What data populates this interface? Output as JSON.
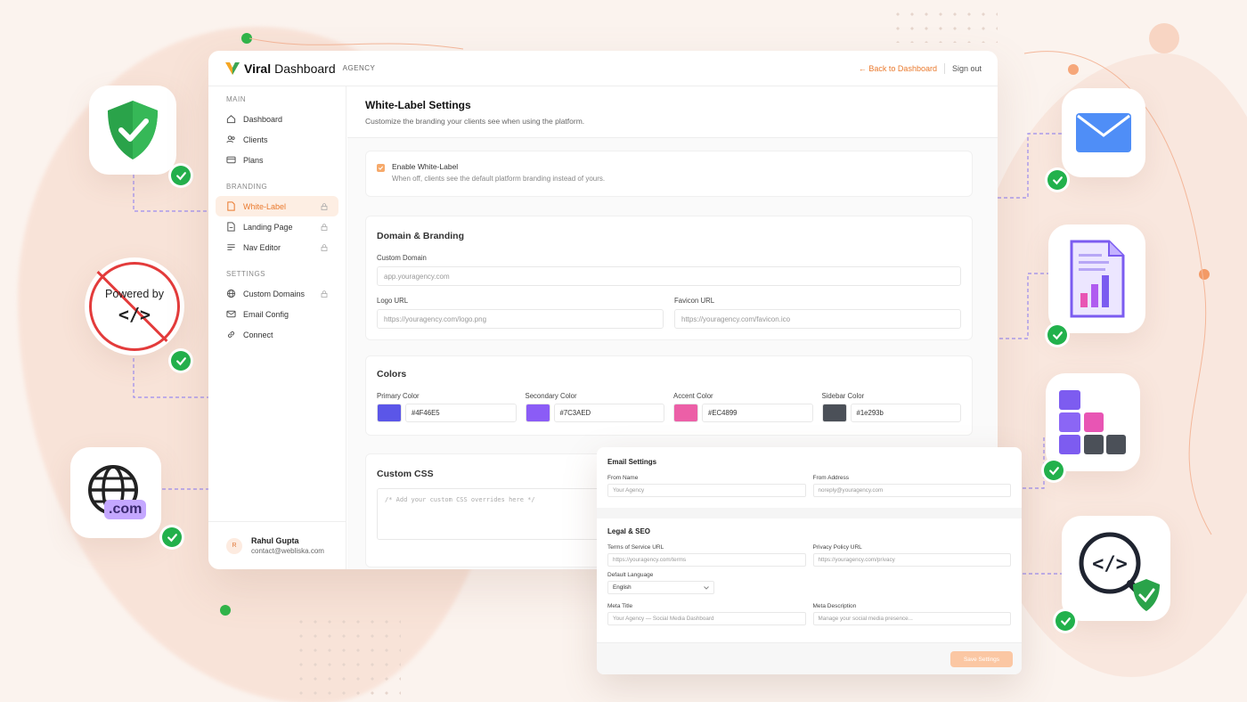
{
  "app": {
    "logo_name": "Viral",
    "logo_suffix": "Dashboard",
    "badge": "AGENCY",
    "back_link": "Back to Dashboard",
    "signout": "Sign out"
  },
  "sidebar": {
    "sections": [
      {
        "title": "MAIN",
        "items": [
          {
            "label": "Dashboard",
            "icon": "home-icon",
            "locked": false,
            "active": false
          },
          {
            "label": "Clients",
            "icon": "users-icon",
            "locked": false,
            "active": false
          },
          {
            "label": "Plans",
            "icon": "card-icon",
            "locked": false,
            "active": false
          }
        ]
      },
      {
        "title": "BRANDING",
        "items": [
          {
            "label": "White-Label",
            "icon": "document-icon",
            "locked": true,
            "active": true
          },
          {
            "label": "Landing Page",
            "icon": "page-icon",
            "locked": true,
            "active": false
          },
          {
            "label": "Nav Editor",
            "icon": "menu-icon",
            "locked": true,
            "active": false
          }
        ]
      },
      {
        "title": "SETTINGS",
        "items": [
          {
            "label": "Custom Domains",
            "icon": "globe-icon",
            "locked": true,
            "active": false
          },
          {
            "label": "Email Config",
            "icon": "mail-icon",
            "locked": false,
            "active": false
          },
          {
            "label": "Connect",
            "icon": "link-icon",
            "locked": false,
            "active": false
          }
        ]
      }
    ],
    "user": {
      "initial": "R",
      "name": "Rahul Gupta",
      "email": "contact@webliska.com"
    }
  },
  "page": {
    "title": "White-Label Settings",
    "subtitle": "Customize the branding your clients see when using the platform.",
    "enable": {
      "label": "Enable White-Label",
      "help": "When off, clients see the default platform branding instead of yours.",
      "checked": true
    },
    "domain": {
      "title": "Domain & Branding",
      "custom_domain_label": "Custom Domain",
      "custom_domain_placeholder": "app.youragency.com",
      "logo_label": "Logo URL",
      "logo_placeholder": "https://youragency.com/logo.png",
      "favicon_label": "Favicon URL",
      "favicon_placeholder": "https://youragency.com/favicon.ico"
    },
    "colors": {
      "title": "Colors",
      "items": [
        {
          "label": "Primary Color",
          "value": "#4F46E5",
          "swatch": "#5b56e8"
        },
        {
          "label": "Secondary Color",
          "value": "#7C3AED",
          "swatch": "#8b5cf6"
        },
        {
          "label": "Accent Color",
          "value": "#EC4899",
          "swatch": "#ec5fa7"
        },
        {
          "label": "Sidebar Color",
          "value": "#1e293b",
          "swatch": "#4b5058"
        }
      ]
    },
    "css": {
      "title": "Custom CSS",
      "placeholder": "/* Add your custom CSS overrides here */"
    }
  },
  "overlay": {
    "email_title": "Email Settings",
    "from_name_label": "From Name",
    "from_name_placeholder": "Your Agency",
    "from_address_label": "From Address",
    "from_address_placeholder": "noreply@youragency.com",
    "legal_title": "Legal & SEO",
    "terms_label": "Terms of Service URL",
    "terms_placeholder": "https://youragency.com/terms",
    "privacy_label": "Privacy Policy URL",
    "privacy_placeholder": "https://youragency.com/privacy",
    "language_label": "Default Language",
    "language_value": "English",
    "meta_title_label": "Meta Title",
    "meta_title_placeholder": "Your Agency — Social Media Dashboard",
    "meta_desc_label": "Meta Description",
    "meta_desc_placeholder": "Manage your social media presence...",
    "save_label": "Save Settings"
  },
  "decor": {
    "powered_by_text": "Powered by",
    "code_glyph": "</>",
    "domain_badge": ".com",
    "colors": {
      "accent": "#ea7a2e",
      "check": "#22b14c",
      "dash": "#9b8cf0"
    }
  }
}
